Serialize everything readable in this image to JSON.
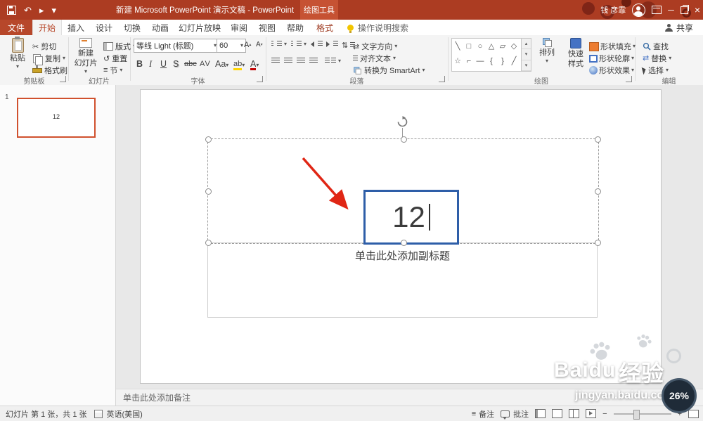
{
  "colors": {
    "titlebar": "#ac3c22",
    "contextual_tab": "#c65233",
    "accent": "#b7472a",
    "selection_blue": "#2e5ea8",
    "arrow_red": "#e02615",
    "thumb_border": "#d0512e",
    "badge_bg": "#1f2b38"
  },
  "titlebar": {
    "title": "新建 Microsoft PowerPoint 演示文稿 - PowerPoint",
    "contextual_header": "绘图工具",
    "user_name": "钱 彦霏"
  },
  "tabs": {
    "file": "文件",
    "home": "开始",
    "insert": "插入",
    "design": "设计",
    "transitions": "切换",
    "animations": "动画",
    "slide_show": "幻灯片放映",
    "review": "审阅",
    "view": "视图",
    "help": "帮助",
    "format": "格式",
    "search_placeholder": "操作说明搜索",
    "share": "共享"
  },
  "ribbon": {
    "clipboard": {
      "label": "剪贴板",
      "paste": "粘贴",
      "cut": "剪切",
      "copy": "复制",
      "format_painter": "格式刷"
    },
    "slides": {
      "label": "幻灯片",
      "new_slide_line1": "新建",
      "new_slide_line2": "幻灯片",
      "layout": "版式",
      "reset": "重置",
      "section": "节"
    },
    "font": {
      "label": "字体",
      "name": "等线 Light (标题)",
      "size": "60",
      "grow": "A",
      "shrink": "A",
      "bold": "B",
      "italic": "I",
      "underline": "U",
      "shadow": "S",
      "strike": "abc",
      "spacing": "AV",
      "case": "Aa",
      "highlight": "ab",
      "color": "A"
    },
    "paragraph": {
      "label": "段落",
      "text_direction": "文字方向",
      "align_text": "对齐文本",
      "smartart": "转换为 SmartArt"
    },
    "drawing": {
      "label": "绘图",
      "arrange": "排列",
      "quick_line1": "快速",
      "quick_line2": "样式",
      "fill": "形状填充",
      "outline": "形状轮廓",
      "effects": "形状效果",
      "shapes": [
        "╲",
        "□",
        "○",
        "△",
        "▱",
        "◇",
        "☆",
        "⌐",
        "—",
        "{",
        "}",
        "╱"
      ]
    },
    "editing": {
      "label": "编辑",
      "find": "查找",
      "replace": "替换",
      "select": "选择"
    }
  },
  "panel": {
    "slide_number": "1",
    "thumb_title": "12"
  },
  "slide": {
    "title_text": "12",
    "subtitle_placeholder": "单击此处添加副标题"
  },
  "notes": {
    "placeholder": "单击此处添加备注"
  },
  "status": {
    "slide_info": "幻灯片 第 1 张，共 1 张",
    "language": "英语(美国)",
    "notes": "备注",
    "comments": "批注",
    "zoom_badge": "26%"
  },
  "watermark": {
    "brand": "Baidu",
    "brand_cn": "经验",
    "url": "jingyan.baidu.com"
  },
  "icons": {
    "caret_down": "▾",
    "caret_up": "▴",
    "undo": "↶",
    "present": "▸",
    "scissors": "✂",
    "reset": "↺",
    "section_icon": "≡",
    "updown": "⇅",
    "swap": "⇄",
    "minus": "−",
    "plus": "+",
    "close": "×",
    "min": "─"
  }
}
